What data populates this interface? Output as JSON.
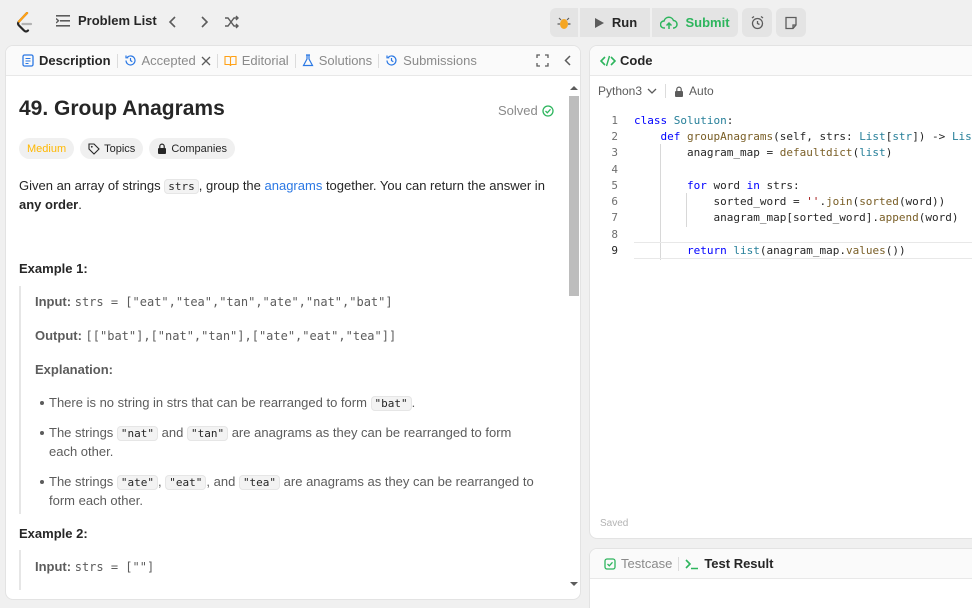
{
  "nav": {
    "problem_list": "Problem List"
  },
  "toolbar": {
    "run_label": "Run",
    "submit_label": "Submit"
  },
  "tabs": [
    {
      "label": "Description",
      "icon": "document-icon"
    },
    {
      "label": "Accepted",
      "icon": "history-icon"
    },
    {
      "label": "Editorial",
      "icon": "book-icon"
    },
    {
      "label": "Solutions",
      "icon": "flask-icon"
    },
    {
      "label": "Submissions",
      "icon": "history-icon"
    }
  ],
  "problem": {
    "title": "49. Group Anagrams",
    "solved_label": "Solved",
    "difficulty": "Medium",
    "topics_label": "Topics",
    "companies_label": "Companies",
    "desc_1": "Given an array of strings ",
    "desc_code": "strs",
    "desc_2": ", group the ",
    "desc_link": "anagrams",
    "desc_3": " together. You can return the answer in ",
    "desc_bold": "any order",
    "desc_4": "."
  },
  "example1": {
    "heading": "Example 1:",
    "input_label": "Input:",
    "input_value": "strs = [\"eat\",\"tea\",\"tan\",\"ate\",\"nat\",\"bat\"]",
    "output_label": "Output:",
    "output_value": "[[\"bat\"],[\"nat\",\"tan\"],[\"ate\",\"eat\",\"tea\"]]",
    "explanation_label": "Explanation:",
    "b1_text": "There is no string in strs that can be rearranged to form ",
    "b1_code": "\"bat\"",
    "b1_end": ".",
    "b2_a": "The strings ",
    "b2_c1": "\"nat\"",
    "b2_b": " and ",
    "b2_c2": "\"tan\"",
    "b2_c": " are anagrams as they can be rearranged to form each other.",
    "b3_a": "The strings ",
    "b3_c1": "\"ate\"",
    "b3_b": ", ",
    "b3_c2": "\"eat\"",
    "b3_c": ", and ",
    "b3_c3": "\"tea\"",
    "b3_d": " are anagrams as they can be rearranged to form each other."
  },
  "example2": {
    "heading": "Example 2:",
    "input_label": "Input:",
    "input_value": "strs = [\"\"]"
  },
  "editor": {
    "title": "Code",
    "language": "Python3",
    "mode": "Auto",
    "saved": "Saved",
    "lines": [
      "1",
      "2",
      "3",
      "4",
      "5",
      "6",
      "7",
      "8",
      "9"
    ]
  },
  "bottom": {
    "testcase": "Testcase",
    "test_result": "Test Result"
  },
  "colors": {
    "accent_green": "#2db55d",
    "medium": "#ffb800",
    "link": "#2b78e4"
  }
}
